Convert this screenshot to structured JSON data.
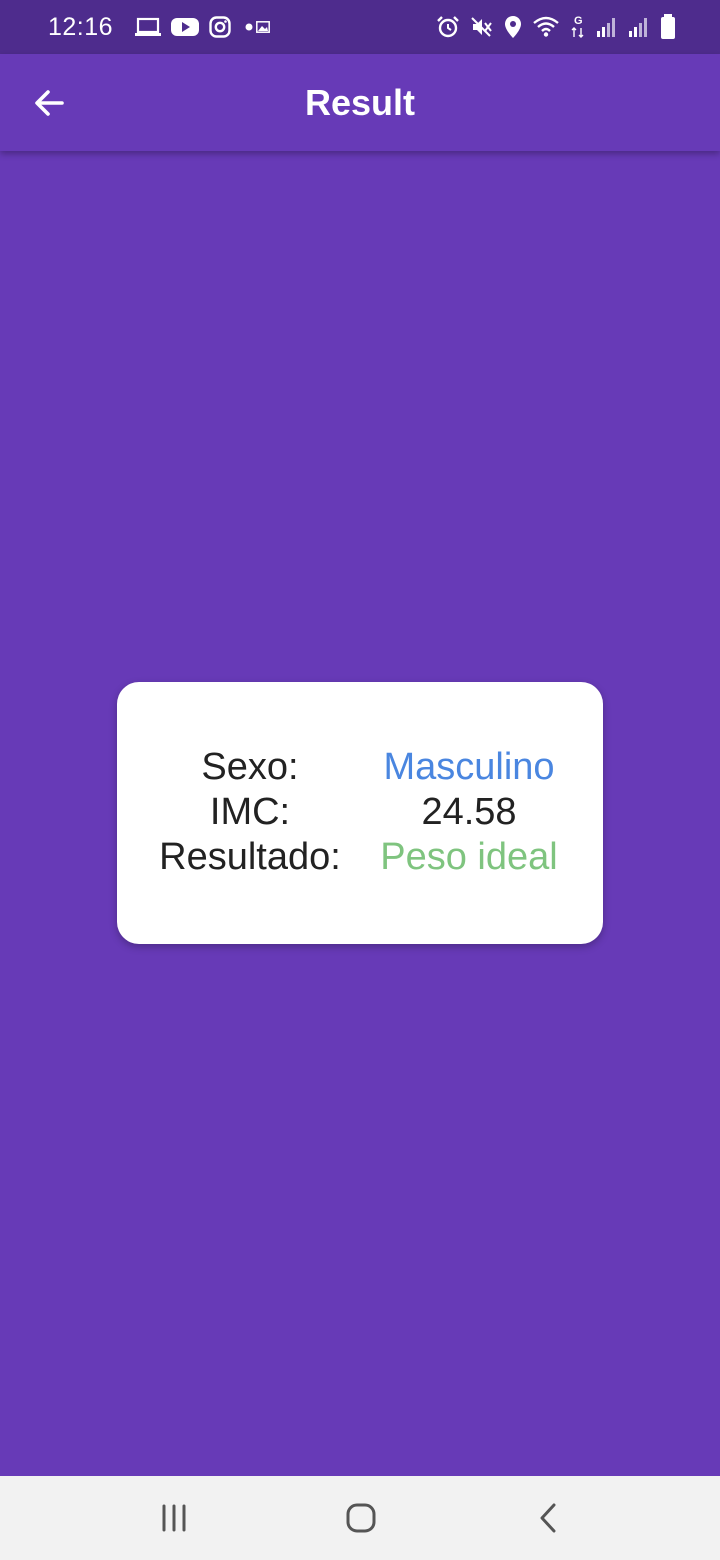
{
  "status_bar": {
    "time": "12:16",
    "left_icons": [
      "laptop-icon",
      "youtube-icon",
      "instagram-icon",
      "dot-icon",
      "image-icon"
    ],
    "right_icons": [
      "alarm-icon",
      "mute-icon",
      "location-icon",
      "wifi-icon",
      "data-g-icon",
      "signal-icon",
      "signal-icon",
      "battery-icon"
    ]
  },
  "app_bar": {
    "title": "Result"
  },
  "result": {
    "sexo_label": "Sexo:",
    "sexo_value": "Masculino",
    "imc_label": "IMC:",
    "imc_value": "24.58",
    "resultado_label": "Resultado:",
    "resultado_value": "Peso ideal"
  },
  "colors": {
    "background": "#673ab7",
    "status_bar": "#4e2c8d",
    "card": "#ffffff",
    "sexo_value": "#4a86e0",
    "resultado_value": "#7fc47f",
    "label_text": "#222222",
    "nav_bar": "#f2f2f2"
  }
}
